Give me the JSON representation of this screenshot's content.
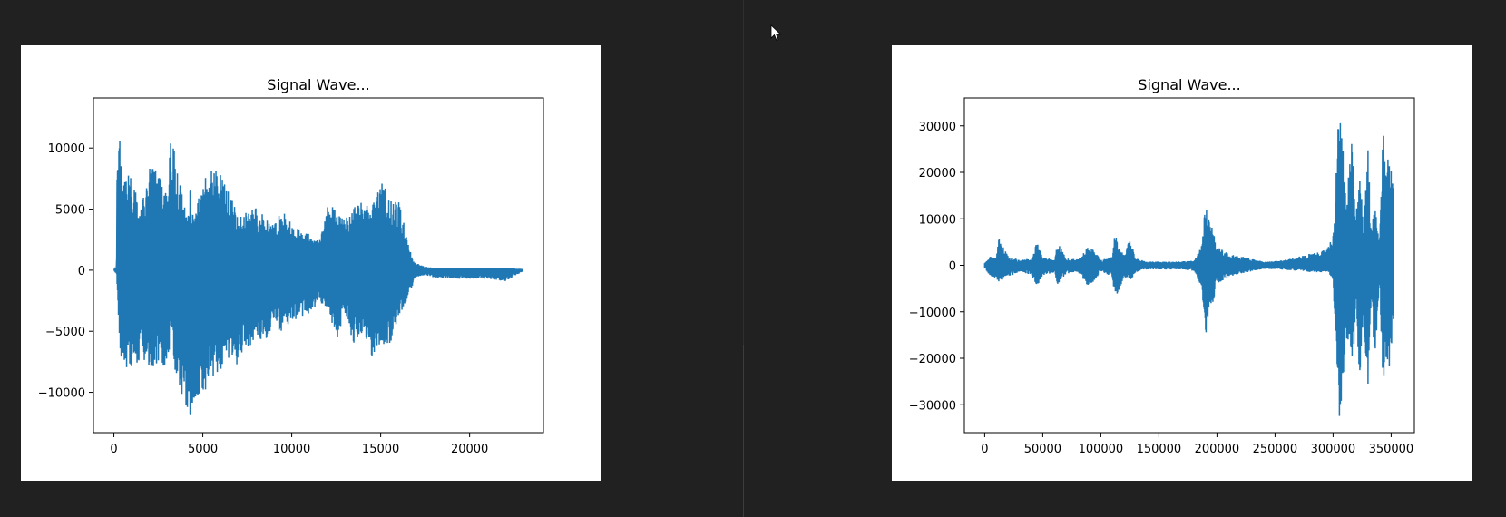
{
  "colors": {
    "background": "#212121",
    "figure": "#ffffff",
    "line": "#1f77b4"
  },
  "chart_data": [
    {
      "type": "line",
      "title": "Signal Wave...",
      "xlabel": "",
      "ylabel": "",
      "xlim": [
        -1150,
        24150
      ],
      "ylim": [
        -13300,
        14100
      ],
      "xticks": [
        0,
        5000,
        10000,
        15000,
        20000
      ],
      "xtick_labels": [
        "0",
        "5000",
        "10000",
        "15000",
        "20000"
      ],
      "yticks": [
        -10000,
        -5000,
        0,
        5000,
        10000
      ],
      "ytick_labels": [
        "−10000",
        "−5000",
        "0",
        "5000",
        "10000"
      ],
      "grid": false,
      "series": [
        {
          "envelope_x": [
            0,
            150,
            200,
            250,
            500,
            1000,
            1500,
            2000,
            2500,
            3000,
            3200,
            3500,
            4000,
            4300,
            4500,
            5000,
            5500,
            6000,
            6500,
            7000,
            7500,
            8000,
            8500,
            9000,
            9500,
            10000,
            10500,
            11000,
            11500,
            12000,
            12500,
            13000,
            13500,
            14000,
            14500,
            15000,
            15500,
            16000,
            16500,
            16800,
            17000,
            17500,
            18000,
            19000,
            20000,
            21000,
            22000,
            23000
          ],
          "upper": [
            0,
            400,
            13000,
            12000,
            8500,
            7500,
            5000,
            9000,
            8000,
            6000,
            11500,
            8800,
            5000,
            6800,
            4000,
            7800,
            8500,
            8100,
            6500,
            4200,
            5000,
            5500,
            4200,
            3800,
            5000,
            3800,
            3200,
            3000,
            2400,
            5600,
            5000,
            4200,
            5200,
            5600,
            5200,
            8000,
            5600,
            5800,
            2600,
            800,
            600,
            300,
            200,
            200,
            200,
            200,
            200,
            100
          ],
          "lower": [
            0,
            -400,
            -2200,
            -5000,
            -8500,
            -7800,
            -7500,
            -8200,
            -7600,
            -8500,
            -5600,
            -9000,
            -10800,
            -12200,
            -11000,
            -10200,
            -9000,
            -8200,
            -7400,
            -7800,
            -6500,
            -5500,
            -5900,
            -4800,
            -5000,
            -4200,
            -3800,
            -3500,
            -2800,
            -3000,
            -6200,
            -3500,
            -6500,
            -5000,
            -7200,
            -6000,
            -6200,
            -3800,
            -2500,
            -1200,
            -600,
            -400,
            -600,
            -700,
            -700,
            -700,
            -900,
            -100
          ]
        }
      ]
    },
    {
      "type": "line",
      "title": "Signal Wave...",
      "xlabel": "",
      "ylabel": "",
      "xlim": [
        -17500,
        370000
      ],
      "ylim": [
        -36000,
        36000
      ],
      "xticks": [
        0,
        50000,
        100000,
        150000,
        200000,
        250000,
        300000,
        350000
      ],
      "xtick_labels": [
        "0",
        "50000",
        "100000",
        "150000",
        "200000",
        "250000",
        "300000",
        "350000"
      ],
      "yticks": [
        -30000,
        -20000,
        -10000,
        0,
        10000,
        20000,
        30000
      ],
      "ytick_labels": [
        "−30000",
        "−20000",
        "−10000",
        "0",
        "10000",
        "20000",
        "30000"
      ],
      "grid": false,
      "series": [
        {
          "envelope_x": [
            0,
            5000,
            10000,
            12000,
            20000,
            30000,
            40000,
            45000,
            50000,
            60000,
            63000,
            70000,
            80000,
            90000,
            92000,
            100000,
            110000,
            112000,
            120000,
            125000,
            130000,
            140000,
            150000,
            160000,
            170000,
            180000,
            187000,
            190000,
            192000,
            195000,
            200000,
            210000,
            220000,
            240000,
            260000,
            280000,
            295000,
            300000,
            305000,
            307000,
            312000,
            316000,
            320000,
            323000,
            326000,
            330000,
            333000,
            336000,
            340000,
            343000,
            346000,
            348000,
            352000
          ],
          "upper": [
            500,
            2000,
            1500,
            6000,
            2000,
            1200,
            1500,
            5000,
            1800,
            1200,
            5000,
            1500,
            1300,
            4200,
            3800,
            1200,
            1800,
            6800,
            2000,
            6000,
            1500,
            800,
            800,
            800,
            900,
            1000,
            4500,
            14000,
            10000,
            9000,
            4000,
            2500,
            2000,
            800,
            1200,
            2500,
            3500,
            7000,
            33000,
            32000,
            15000,
            28000,
            12000,
            22000,
            8000,
            26000,
            7000,
            15000,
            4000,
            30000,
            20000,
            25000,
            18000
          ],
          "lower": [
            -500,
            -2500,
            -3000,
            -3500,
            -2500,
            -1500,
            -2000,
            -4500,
            -2200,
            -1500,
            -4200,
            -1800,
            -1500,
            -4800,
            -4200,
            -1500,
            -2500,
            -8000,
            -2500,
            -3500,
            -1500,
            -900,
            -900,
            -900,
            -900,
            -1200,
            -5000,
            -18000,
            -12000,
            -10000,
            -4000,
            -2500,
            -1800,
            -800,
            -1000,
            -1500,
            -1500,
            -3500,
            -32500,
            -33000,
            -15000,
            -24000,
            -10000,
            -30000,
            -10000,
            -27000,
            -7000,
            -24000,
            -4000,
            -26000,
            -20000,
            -24000,
            -12000
          ]
        }
      ]
    }
  ]
}
